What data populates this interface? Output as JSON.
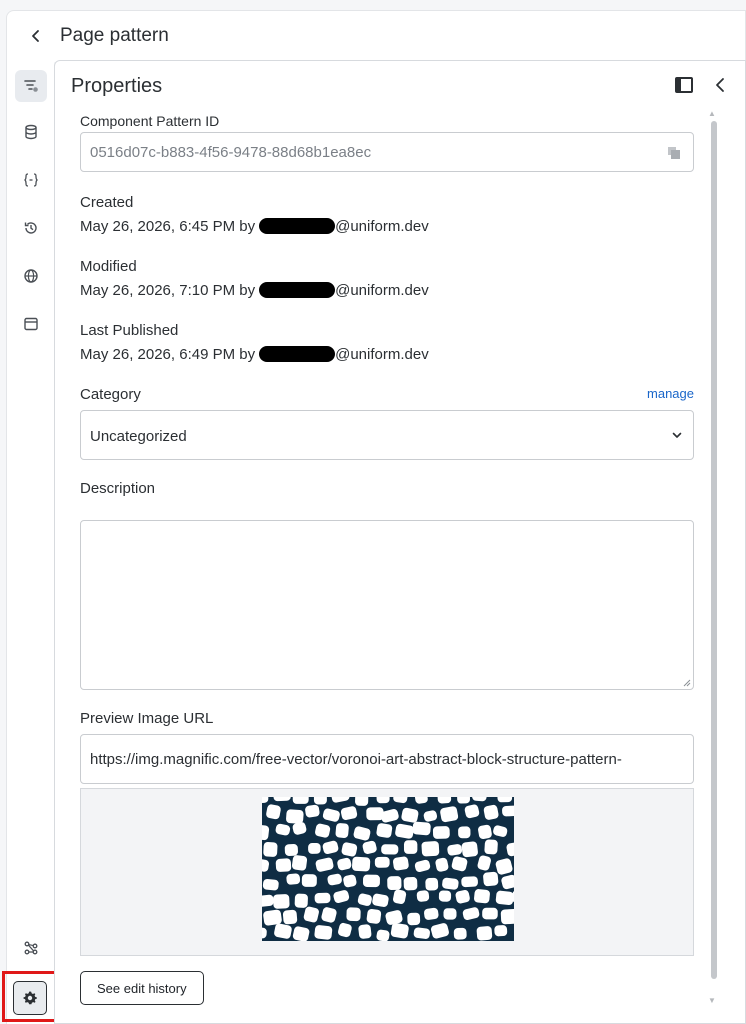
{
  "header": {
    "title": "Page pattern"
  },
  "rail": {
    "items": [
      {
        "icon": "component-tree-icon",
        "active": true
      },
      {
        "icon": "database-icon",
        "active": false
      },
      {
        "icon": "braces-icon",
        "active": false
      },
      {
        "icon": "history-icon",
        "active": false
      },
      {
        "icon": "globe-icon",
        "active": false
      },
      {
        "icon": "archive-icon",
        "active": false
      }
    ],
    "bottom": [
      "graph-icon",
      "gear-icon"
    ]
  },
  "panel": {
    "title": "Properties",
    "pattern_id": {
      "label": "Component Pattern ID",
      "value": "0516d07c-b883-4f56-9478-88d68b1ea8ec"
    },
    "created": {
      "label": "Created",
      "value": "May 26, 2026, 6:45 PM by",
      "email_suffix": "@uniform.dev"
    },
    "modified": {
      "label": "Modified",
      "value": "May 26, 2026, 7:10 PM by",
      "email_suffix": "@uniform.dev"
    },
    "published": {
      "label": "Last Published",
      "value": "May 26, 2026, 6:49 PM by",
      "email_suffix": "@uniform.dev"
    },
    "category": {
      "label": "Category",
      "manage_label": "manage",
      "selected": "Uncategorized"
    },
    "description": {
      "label": "Description",
      "value": ""
    },
    "preview_url": {
      "label": "Preview Image URL",
      "value": "https://img.magnific.com/free-vector/voronoi-art-abstract-block-structure-pattern-"
    },
    "edit_history_label": "See edit history"
  },
  "colors": {
    "accent_link": "#1a66c9",
    "highlight": "#e01818",
    "pattern_dark": "#0f2d44"
  }
}
